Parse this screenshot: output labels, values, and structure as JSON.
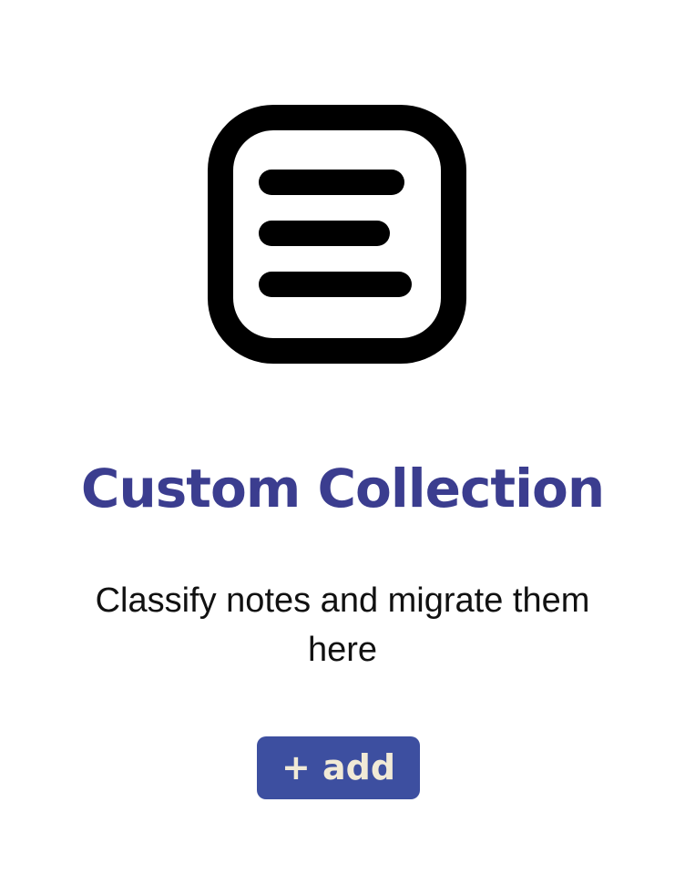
{
  "icon": {
    "name": "notes-list-icon",
    "stroke_color": "#000000"
  },
  "empty_state": {
    "title": "Custom Collection",
    "description": "Classify notes and migrate them here",
    "add_label": "+ add"
  },
  "colors": {
    "title": "#3b3d8f",
    "button_background": "#3d4fa0",
    "button_text": "#f1ead6"
  }
}
